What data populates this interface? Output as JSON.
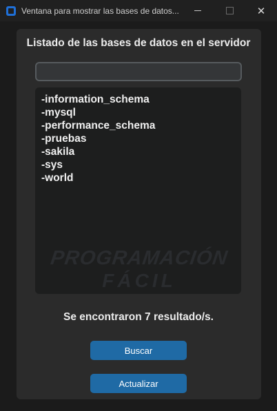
{
  "window": {
    "title": "Ventana para mostrar las bases de datos...",
    "controls": {
      "minimize": "—",
      "maximize": "☐",
      "close": "✕"
    }
  },
  "main": {
    "heading": "Listado de las bases de datos en el servidor",
    "search": {
      "value": "",
      "placeholder": ""
    },
    "databases": [
      "-information_schema",
      "-mysql",
      "-performance_schema",
      "-pruebas",
      "-sakila",
      "-sys",
      "-world"
    ],
    "watermark": {
      "line1": "PROGRAMACIÓN",
      "line2": "FÁCIL"
    },
    "result_text": "Se encontraron 7 resultado/s.",
    "buttons": {
      "search": "Buscar",
      "refresh": "Actualizar"
    }
  },
  "colors": {
    "background": "#1b1b1b",
    "panel": "#2b2b2b",
    "listbox": "#1d1e1e",
    "button": "#1f6aa5",
    "text": "#ececec"
  }
}
